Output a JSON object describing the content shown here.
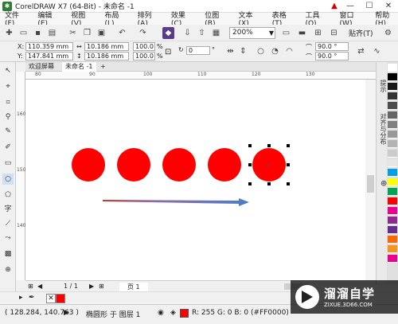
{
  "window": {
    "title": "CorelDRAW X7 (64-Bit) - 未命名 -1",
    "minimize": "—",
    "maximize": "☐",
    "close": "✕"
  },
  "menu": [
    "文件(F)",
    "编辑(E)",
    "视图(V)",
    "布局(L)",
    "排列(A)",
    "效果(C)",
    "位图(B)",
    "文本(X)",
    "表格(T)",
    "工具(O)",
    "窗口(W)",
    "帮助(H)"
  ],
  "toolbar": {
    "zoom": "200%",
    "snap_label": "贴齐(T)"
  },
  "properties": {
    "x": "110.359 mm",
    "y": "147.841 mm",
    "x_label": "X:",
    "y_label": "Y:",
    "width": "10.186 mm",
    "height": "10.186 mm",
    "scale_w": "100.0",
    "scale_h": "100.0",
    "pct": "%",
    "rotation": "0",
    "deg": "°",
    "angle1": "90.0 °",
    "angle2": "90.0 °"
  },
  "tabs": [
    "欢迎屏幕",
    "未命名 -1"
  ],
  "tab_add": "+",
  "ruler": {
    "h": [
      "80",
      "90",
      "100",
      "110",
      "120",
      "130"
    ],
    "v": [
      "160",
      "150",
      "140"
    ]
  },
  "dockers": [
    "提示",
    "对齐与分布"
  ],
  "palette": [
    "#ffffff",
    "#000000",
    "#1a1a1a",
    "#333333",
    "#4d4d4d",
    "#666666",
    "#808080",
    "#999999",
    "#b3b3b3",
    "#cccccc",
    "#e6e6e6",
    "#00a0e9",
    "#ffff00",
    "#00a651",
    "#ff0000",
    "#ec008c",
    "#92278f",
    "#662d91",
    "#ff6600",
    "#f7941d",
    "#ec008c"
  ],
  "page_nav": {
    "counter": "1 / 1",
    "page_tab": "页 1"
  },
  "status": {
    "coords": "( 128.284, 140.763 )",
    "object": "椭圆形 于 图层 1",
    "fill": "R: 255 G: 0 B: 0 (#FF0000)",
    "fill_color": "#ff0000"
  },
  "drawing": {
    "circle_color": "#ff0000",
    "circle_count": 5,
    "arrow_color": "#4a7fc1"
  },
  "watermark": {
    "title": "溜溜自学",
    "url": "ZIXUE.3D66.COM"
  }
}
